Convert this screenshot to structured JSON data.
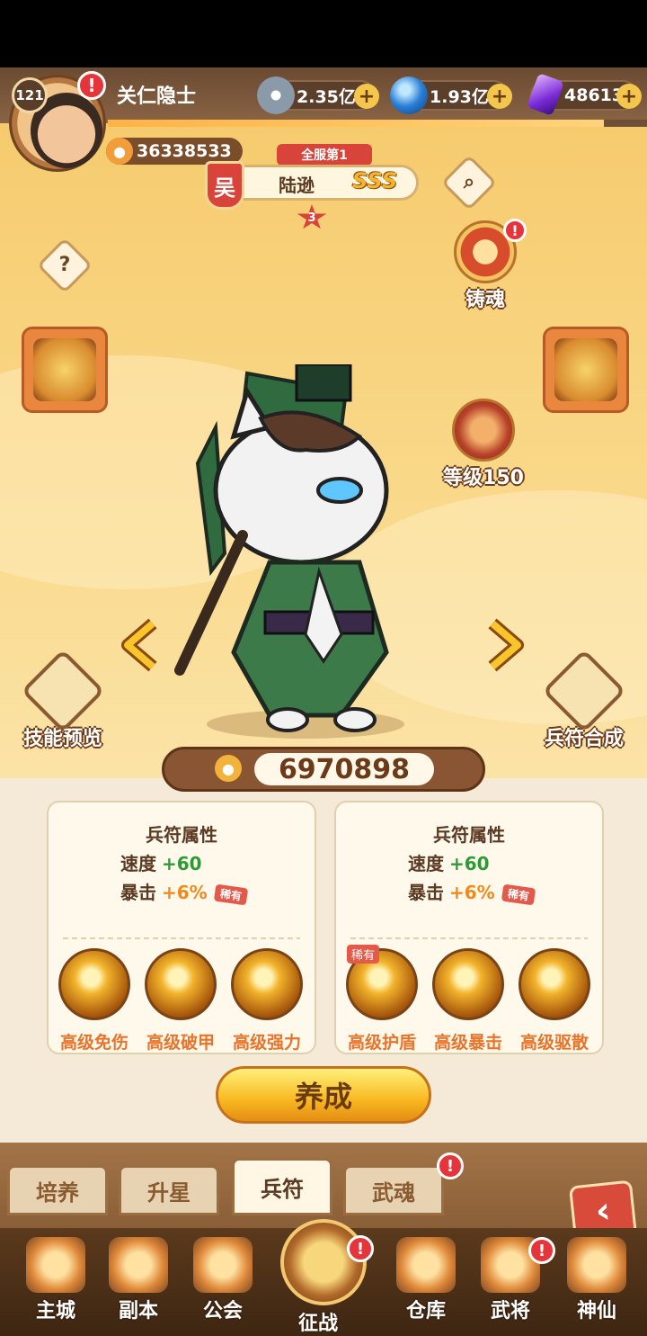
{
  "player": {
    "name": "关仁隐士",
    "level": "121",
    "power": "36338533",
    "xp_fraction": 0.92
  },
  "resources": [
    {
      "icon": "coin-icon",
      "value": "2.35亿"
    },
    {
      "icon": "blue-orb-icon",
      "value": "1.93亿"
    },
    {
      "icon": "purple-crystal-icon",
      "value": "48613"
    }
  ],
  "hero": {
    "rank": "全服第1",
    "faction": "吴",
    "name": "陆逊",
    "grade": "SSS",
    "stars": "3",
    "power": "6970898"
  },
  "features": {
    "forge_soul": "铸魂",
    "level": "等级150",
    "skill_preview": "技能预览",
    "tally_combine": "兵符合成"
  },
  "cards": [
    {
      "title": "兵符属性",
      "attrs": [
        {
          "label": "速度",
          "value": "+60",
          "rare": ""
        },
        {
          "label": "暴击",
          "value": "+6%",
          "rare": "稀有"
        }
      ],
      "skills": [
        {
          "name": "高级免伤",
          "rare": ""
        },
        {
          "name": "高级破甲",
          "rare": ""
        },
        {
          "name": "高级强力",
          "rare": ""
        }
      ]
    },
    {
      "title": "兵符属性",
      "attrs": [
        {
          "label": "速度",
          "value": "+60",
          "rare": ""
        },
        {
          "label": "暴击",
          "value": "+6%",
          "rare": "稀有"
        }
      ],
      "skills": [
        {
          "name": "高级护盾",
          "rare": "稀有"
        },
        {
          "name": "高级暴击",
          "rare": ""
        },
        {
          "name": "高级驱散",
          "rare": ""
        }
      ]
    }
  ],
  "train_button": "养成",
  "tabs": [
    "培养",
    "升星",
    "兵符",
    "武魂"
  ],
  "nav": [
    "主城",
    "副本",
    "公会",
    "征战",
    "仓库",
    "武将",
    "神仙"
  ],
  "colors": {
    "accent": "#f8b820",
    "alert": "#e5353a",
    "green": "#2e9a35",
    "orange": "#f08a1e"
  }
}
